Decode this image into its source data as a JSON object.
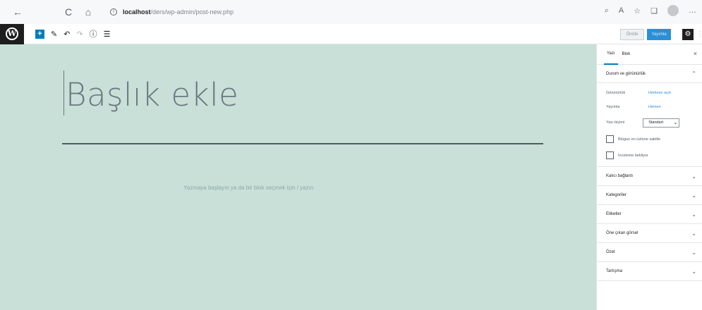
{
  "browser": {
    "back_icon": "←",
    "reload_icon": "C",
    "home_icon": "⌂",
    "info_icon": "i",
    "url_host": "localhost",
    "url_path": "/ders/wp-admin/post-new.php",
    "right_icons": [
      "⌕",
      "A",
      "☆",
      "❏",
      "…"
    ]
  },
  "toolbar": {
    "logo": "W",
    "add_block": "+",
    "edit_icon": "✎",
    "undo_icon": "↶",
    "redo_icon": "↷",
    "info_icon": "ⓘ",
    "outline_icon": "☰",
    "preview_label": "Önizle",
    "publish_label": "Yayımla",
    "settings_icon": "⚙",
    "more_icon": "⋮"
  },
  "editor": {
    "title_placeholder": "Başlık ekle",
    "body_placeholder": "Yazmaya başlayın ya da bir blok seçmek için / yazın"
  },
  "sidebar": {
    "tab_post": "Yazı",
    "tab_block": "Blok",
    "close_icon": "×",
    "status_panel": {
      "title": "Durum ve görünürlük",
      "visibility_label": "Görünürlük",
      "visibility_value": "Herkese açık",
      "publish_label": "Yayımla",
      "publish_value": "Hemen",
      "format_label": "Yazı biçimi",
      "format_value": "Standart",
      "sticky_label": "Blogun en üstüne sabitle",
      "pending_label": "İnceleme bekliyor"
    },
    "sections": [
      "Kalıcı bağlantı",
      "Kategoriler",
      "Etiketler",
      "Öne çıkan görsel",
      "Özet",
      "Tartışma"
    ],
    "chevron_up": "⌃",
    "chevron_down": "⌄"
  }
}
